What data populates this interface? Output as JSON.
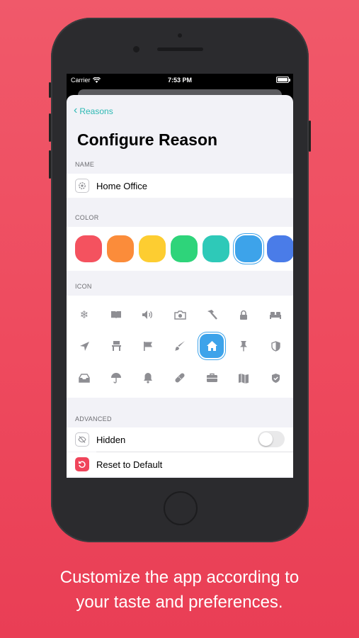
{
  "statusbar": {
    "carrier": "Carrier",
    "time": "7:53 PM"
  },
  "nav": {
    "back_label": "Reasons"
  },
  "page": {
    "title": "Configure Reason"
  },
  "sections": {
    "name": "NAME",
    "color": "COLOR",
    "icon": "ICON",
    "advanced": "ADVANCED"
  },
  "name_field": {
    "value": "Home Office",
    "icon": "gear-icon"
  },
  "colors": {
    "swatches": [
      "#f4525f",
      "#fb8c3a",
      "#fdcd31",
      "#2ed47a",
      "#2ec9b8",
      "#3da3ea",
      "#4a7ce8"
    ],
    "selected_index": 5
  },
  "icons": {
    "rows": [
      [
        "snowflake-icon",
        "book-icon",
        "speaker-icon",
        "camera-icon",
        "hammer-icon",
        "lock-icon",
        "bed-icon"
      ],
      [
        "location-arrow-icon",
        "chair-icon",
        "flag-icon",
        "paintbrush-icon",
        "house-icon",
        "pin-icon",
        "shield-icon"
      ],
      [
        "tray-icon",
        "umbrella-icon",
        "bell-icon",
        "bandage-icon",
        "briefcase-icon",
        "map-icon",
        "shield-check-icon"
      ]
    ],
    "selected": "house-icon"
  },
  "advanced": {
    "hidden_label": "Hidden",
    "hidden_on": false,
    "reset_label": "Reset to Default"
  },
  "caption": {
    "line1": "Customize the app according to",
    "line2": "your taste and preferences."
  }
}
